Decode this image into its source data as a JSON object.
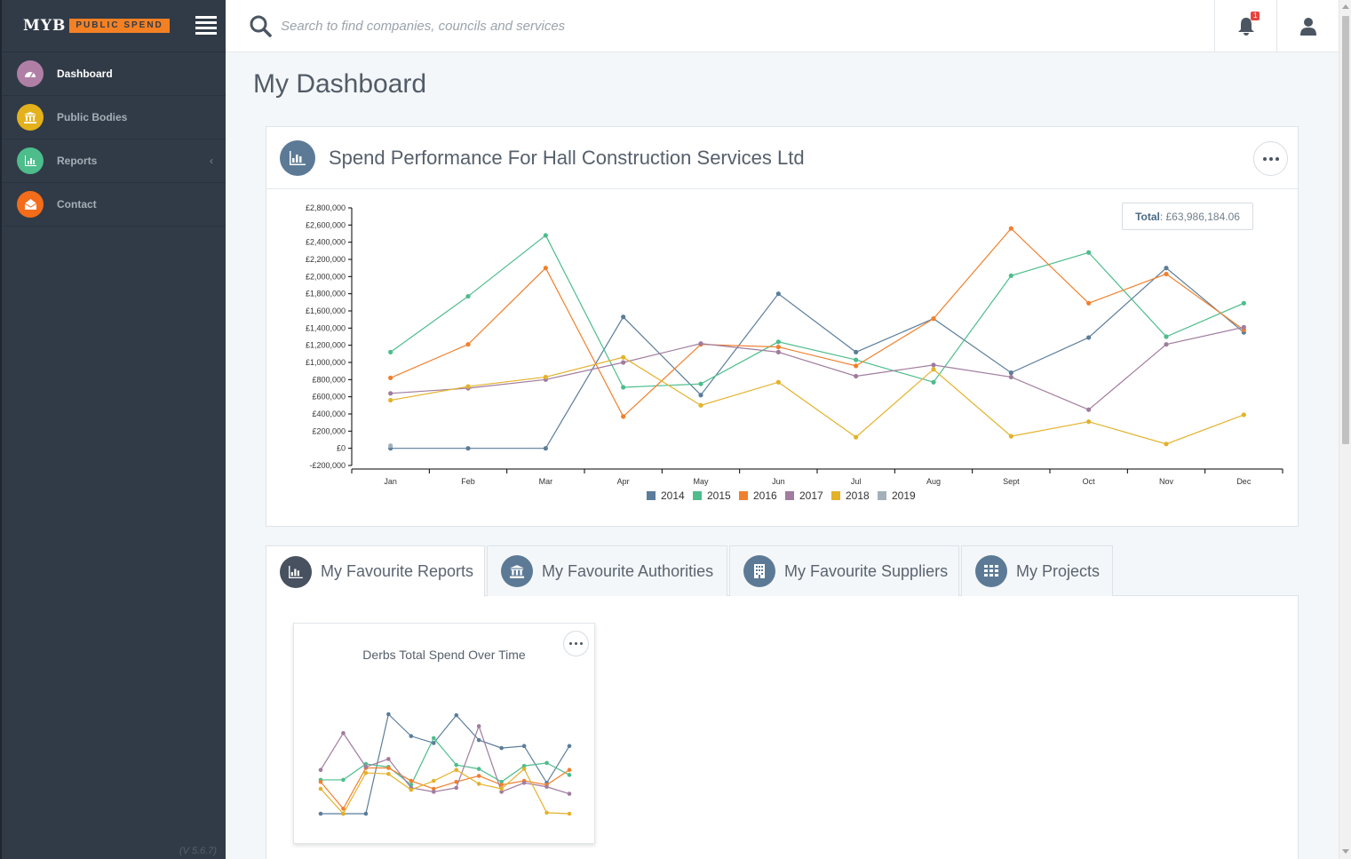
{
  "brand": {
    "name": "MYB",
    "product": "PUBLIC SPEND"
  },
  "version": "(V 5.6.7)",
  "nav": [
    {
      "label": "Dashboard",
      "icon": "dashboard-icon",
      "color": "#b07fa6",
      "active": true
    },
    {
      "label": "Public Bodies",
      "icon": "bank-icon",
      "color": "#e3b11b",
      "active": false
    },
    {
      "label": "Reports",
      "icon": "bar-chart-icon",
      "color": "#4dbd8c",
      "active": false
    },
    {
      "label": "Contact",
      "icon": "envelope-icon",
      "color": "#f36c1a",
      "active": false
    }
  ],
  "search": {
    "placeholder": "Search to find companies, councils and services",
    "value": ""
  },
  "notifications": {
    "count": "1"
  },
  "page": {
    "title": "My Dashboard"
  },
  "spend_panel": {
    "title": "Spend Performance For Hall Construction Services Ltd",
    "total_label": "Total",
    "total_value": ": £63,986,184.06"
  },
  "chart_data": {
    "type": "line",
    "categories": [
      "Jan",
      "Feb",
      "Mar",
      "Apr",
      "May",
      "Jun",
      "Jul",
      "Aug",
      "Sept",
      "Oct",
      "Nov",
      "Dec"
    ],
    "ylim": [
      -200000,
      2800000
    ],
    "yticks": [
      "£2,800,000",
      "£2,600,000",
      "£2,400,000",
      "£2,200,000",
      "£2,000,000",
      "£1,800,000",
      "£1,600,000",
      "£1,400,000",
      "£1,200,000",
      "£1,000,000",
      "£800,000",
      "£600,000",
      "£400,000",
      "£200,000",
      "£0",
      "-£200,000"
    ],
    "legend_position": "bottom",
    "series": [
      {
        "name": "2014",
        "color": "#5b7d9a",
        "values": [
          0,
          0,
          0,
          1530000,
          620000,
          1800000,
          1120000,
          1510000,
          880000,
          1290000,
          2100000,
          1350000
        ]
      },
      {
        "name": "2015",
        "color": "#4dbd8c",
        "values": [
          1120000,
          1770000,
          2480000,
          710000,
          750000,
          1240000,
          1030000,
          770000,
          2010000,
          2280000,
          1300000,
          1690000
        ]
      },
      {
        "name": "2016",
        "color": "#f0802d",
        "values": [
          820000,
          1210000,
          2100000,
          370000,
          1210000,
          1180000,
          960000,
          1510000,
          2560000,
          1690000,
          2030000,
          1380000
        ]
      },
      {
        "name": "2017",
        "color": "#a07c9e",
        "values": [
          640000,
          700000,
          800000,
          1000000,
          1220000,
          1120000,
          840000,
          970000,
          830000,
          450000,
          1210000,
          1410000
        ]
      },
      {
        "name": "2018",
        "color": "#e3b22b",
        "values": [
          560000,
          720000,
          830000,
          1060000,
          500000,
          770000,
          130000,
          920000,
          140000,
          310000,
          50000,
          390000
        ]
      },
      {
        "name": "2019",
        "color": "#a3b0ba",
        "values": [
          30000,
          null,
          null,
          null,
          null,
          null,
          null,
          null,
          null,
          null,
          null,
          null
        ]
      }
    ]
  },
  "tabs": [
    {
      "label": "My Favourite Reports",
      "icon": "bar-chart-icon",
      "active": true
    },
    {
      "label": "My Favourite Authorities",
      "icon": "bank-icon",
      "active": false
    },
    {
      "label": "My Favourite Suppliers",
      "icon": "building-icon",
      "active": false
    },
    {
      "label": "My Projects",
      "icon": "grid-icon",
      "active": false
    }
  ],
  "report_card": {
    "title": "Derbs Total Spend Over Time",
    "chart_data": {
      "type": "line",
      "ylim": [
        0,
        1
      ],
      "series": [
        {
          "color": "#5b7d9a",
          "values": [
            0.0,
            0.0,
            0.0,
            1.0,
            0.78,
            0.71,
            0.99,
            0.74,
            0.66,
            0.68,
            0.31,
            0.68
          ]
        },
        {
          "color": "#4dbd8c",
          "values": [
            0.34,
            0.34,
            0.5,
            0.47,
            0.29,
            0.76,
            0.49,
            0.45,
            0.32,
            0.48,
            0.51,
            0.39
          ]
        },
        {
          "color": "#f0802d",
          "values": [
            0.32,
            0.05,
            0.46,
            0.46,
            0.33,
            0.25,
            0.32,
            0.38,
            0.29,
            0.33,
            0.29,
            0.44
          ]
        },
        {
          "color": "#a07c9e",
          "values": [
            0.44,
            0.81,
            0.47,
            0.55,
            0.26,
            0.22,
            0.26,
            0.88,
            0.22,
            0.31,
            0.27,
            0.2
          ]
        },
        {
          "color": "#e3b22b",
          "values": [
            0.25,
            0.0,
            0.41,
            0.4,
            0.24,
            0.33,
            0.44,
            0.3,
            0.25,
            0.45,
            0.01,
            0.0
          ]
        }
      ]
    }
  }
}
